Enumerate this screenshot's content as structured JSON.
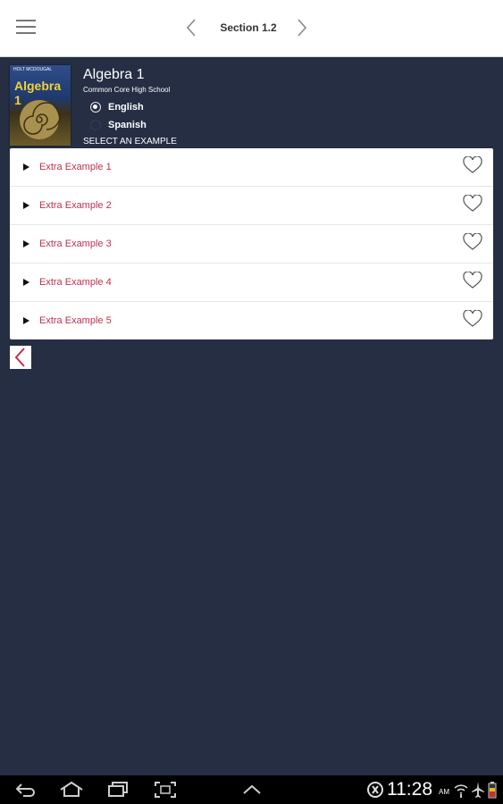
{
  "header": {
    "section_title": "Section 1.2",
    "menu_icon": "hamburger-menu-icon",
    "prev_icon": "chevron-left-icon",
    "next_icon": "chevron-right-icon"
  },
  "book": {
    "title": "Algebra 1",
    "subtitle": "Common Core High School",
    "cover_title": "Algebra 1",
    "cover_publisher": "HOLT MCDOUGAL"
  },
  "language": {
    "options": [
      {
        "label": "English",
        "selected": true
      },
      {
        "label": "Spanish",
        "selected": false
      }
    ]
  },
  "select_label": "SELECT AN EXAMPLE",
  "examples": [
    {
      "label": "Extra Example 1"
    },
    {
      "label": "Extra Example 2"
    },
    {
      "label": "Extra Example 3"
    },
    {
      "label": "Extra Example 4"
    },
    {
      "label": "Extra Example 5"
    }
  ],
  "colors": {
    "background": "#262e44",
    "accent_text": "#c0304e",
    "back_arrow": "#c0304e"
  },
  "status_bar": {
    "time": "11:28",
    "ampm": "AM"
  }
}
